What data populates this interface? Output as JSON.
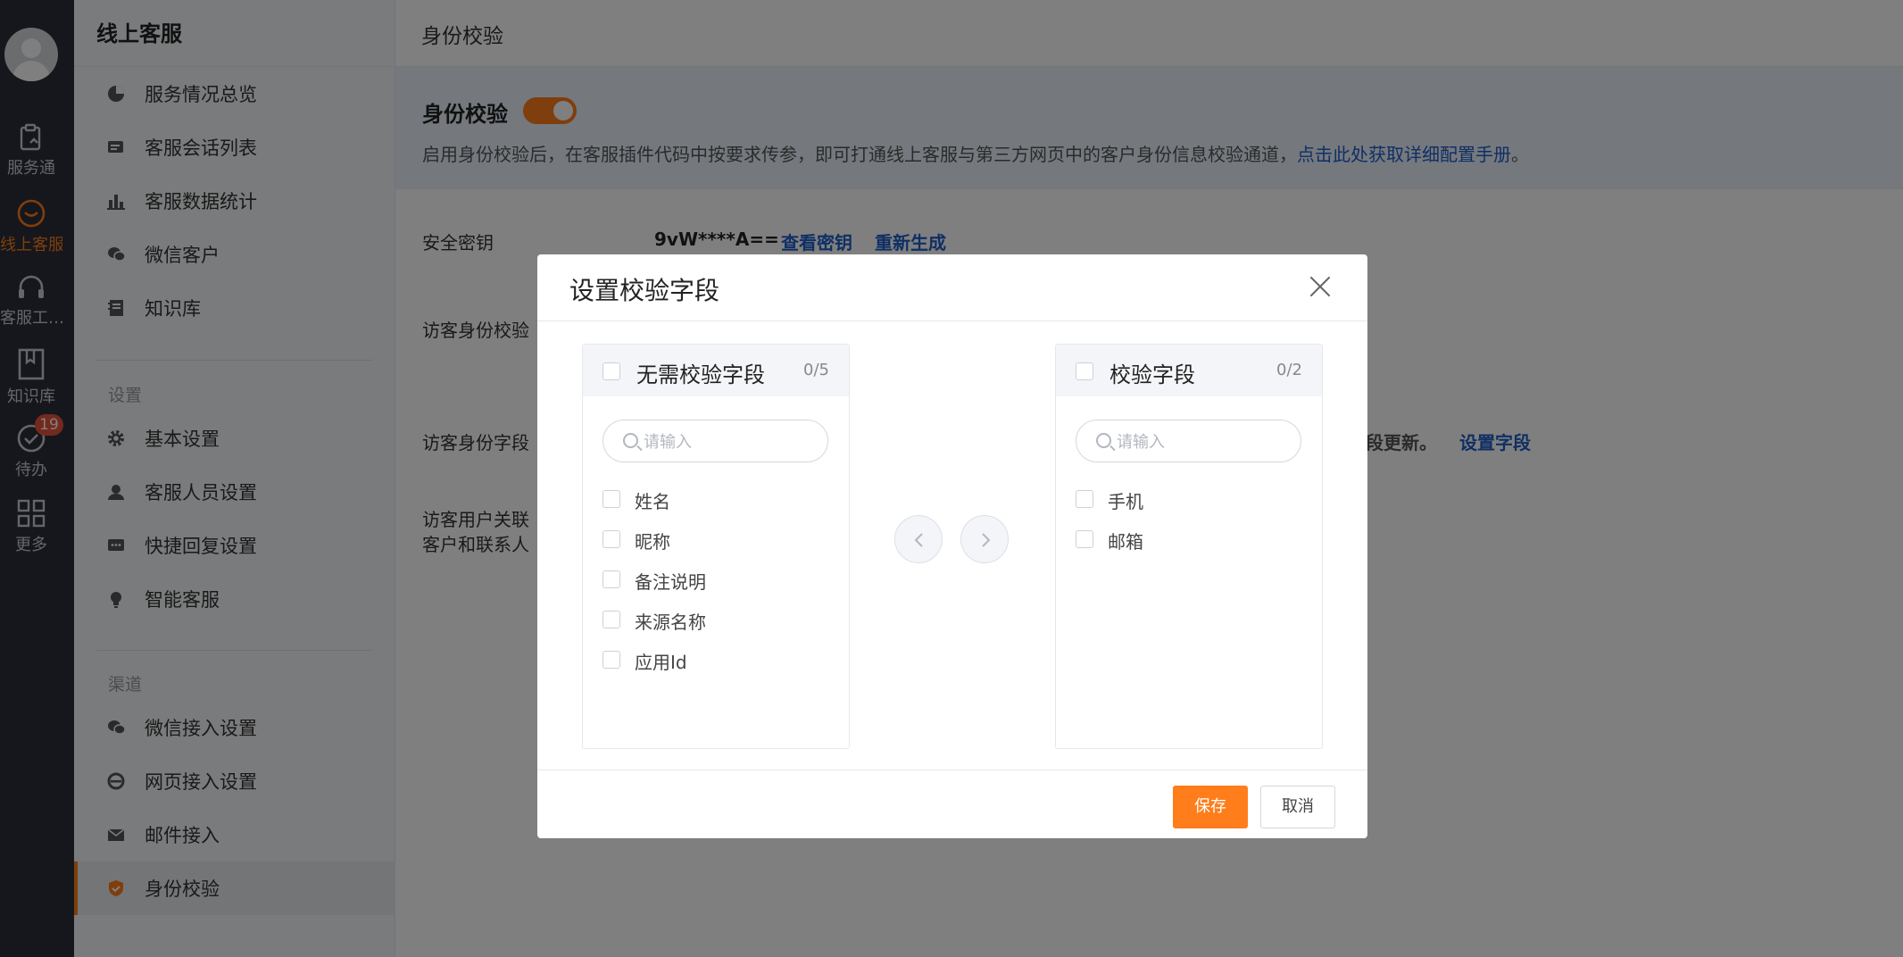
{
  "rail": {
    "items": [
      {
        "label": "服务通",
        "icon": "service-icon"
      },
      {
        "label": "线上客服",
        "icon": "chat-smile-icon"
      },
      {
        "label": "客服工…",
        "icon": "headset-icon"
      },
      {
        "label": "知识库",
        "icon": "book-icon"
      },
      {
        "label": "待办",
        "icon": "check-circle-icon"
      },
      {
        "label": "更多",
        "icon": "grid-icon"
      }
    ],
    "todo_badge": "19",
    "accent": "#ff7d1a"
  },
  "sidebar": {
    "title": "线上客服",
    "items": [
      {
        "label": "服务情况总览",
        "icon": "pie-chart-icon"
      },
      {
        "label": "客服会话列表",
        "icon": "chat-list-icon"
      },
      {
        "label": "客服数据统计",
        "icon": "bar-chart-icon"
      },
      {
        "label": "微信客户",
        "icon": "wechat-icon"
      },
      {
        "label": "知识库",
        "icon": "notebook-icon"
      }
    ],
    "settings_title": "设置",
    "settings": [
      {
        "label": "基本设置",
        "icon": "gear-icon"
      },
      {
        "label": "客服人员设置",
        "icon": "agent-icon"
      },
      {
        "label": "快捷回复设置",
        "icon": "quick-reply-icon"
      },
      {
        "label": "智能客服",
        "icon": "bulb-icon"
      }
    ],
    "channels_title": "渠道",
    "channels": [
      {
        "label": "微信接入设置",
        "icon": "wechat-icon"
      },
      {
        "label": "网页接入设置",
        "icon": "browser-icon"
      },
      {
        "label": "邮件接入",
        "icon": "mail-icon"
      },
      {
        "label": "身份校验",
        "icon": "shield-check-icon"
      }
    ]
  },
  "main": {
    "title": "身份校验",
    "banner": {
      "title": "身份校验",
      "toggle_on": true,
      "desc": "启用身份校验后，在客服插件代码中按要求传参，即可打通线上客服与第三方网页中的客户身份信息校验通道，",
      "desc_link": "点击此处获取详细配置手册",
      "desc_end": "。"
    },
    "secret_label": "安全密钥",
    "secret_value": "9vW****A==",
    "view_key": "查看密钥",
    "regenerate": "重新生成",
    "row2_label": "访客身份校验",
    "row3_label": "访客身份字段",
    "row3_tail": "段更新。",
    "set_fields": "设置字段",
    "row4_label_1": "访客用户关联",
    "row4_label_2": "客户和联系人"
  },
  "modal": {
    "title": "设置校验字段",
    "left": {
      "title": "无需校验字段",
      "count": "0/5",
      "placeholder": "请输入",
      "items": [
        "姓名",
        "昵称",
        "备注说明",
        "来源名称",
        "应用Id"
      ]
    },
    "right": {
      "title": "校验字段",
      "count": "0/2",
      "placeholder": "请输入",
      "items": [
        "手机",
        "邮箱"
      ]
    },
    "save": "保存",
    "cancel": "取消"
  }
}
